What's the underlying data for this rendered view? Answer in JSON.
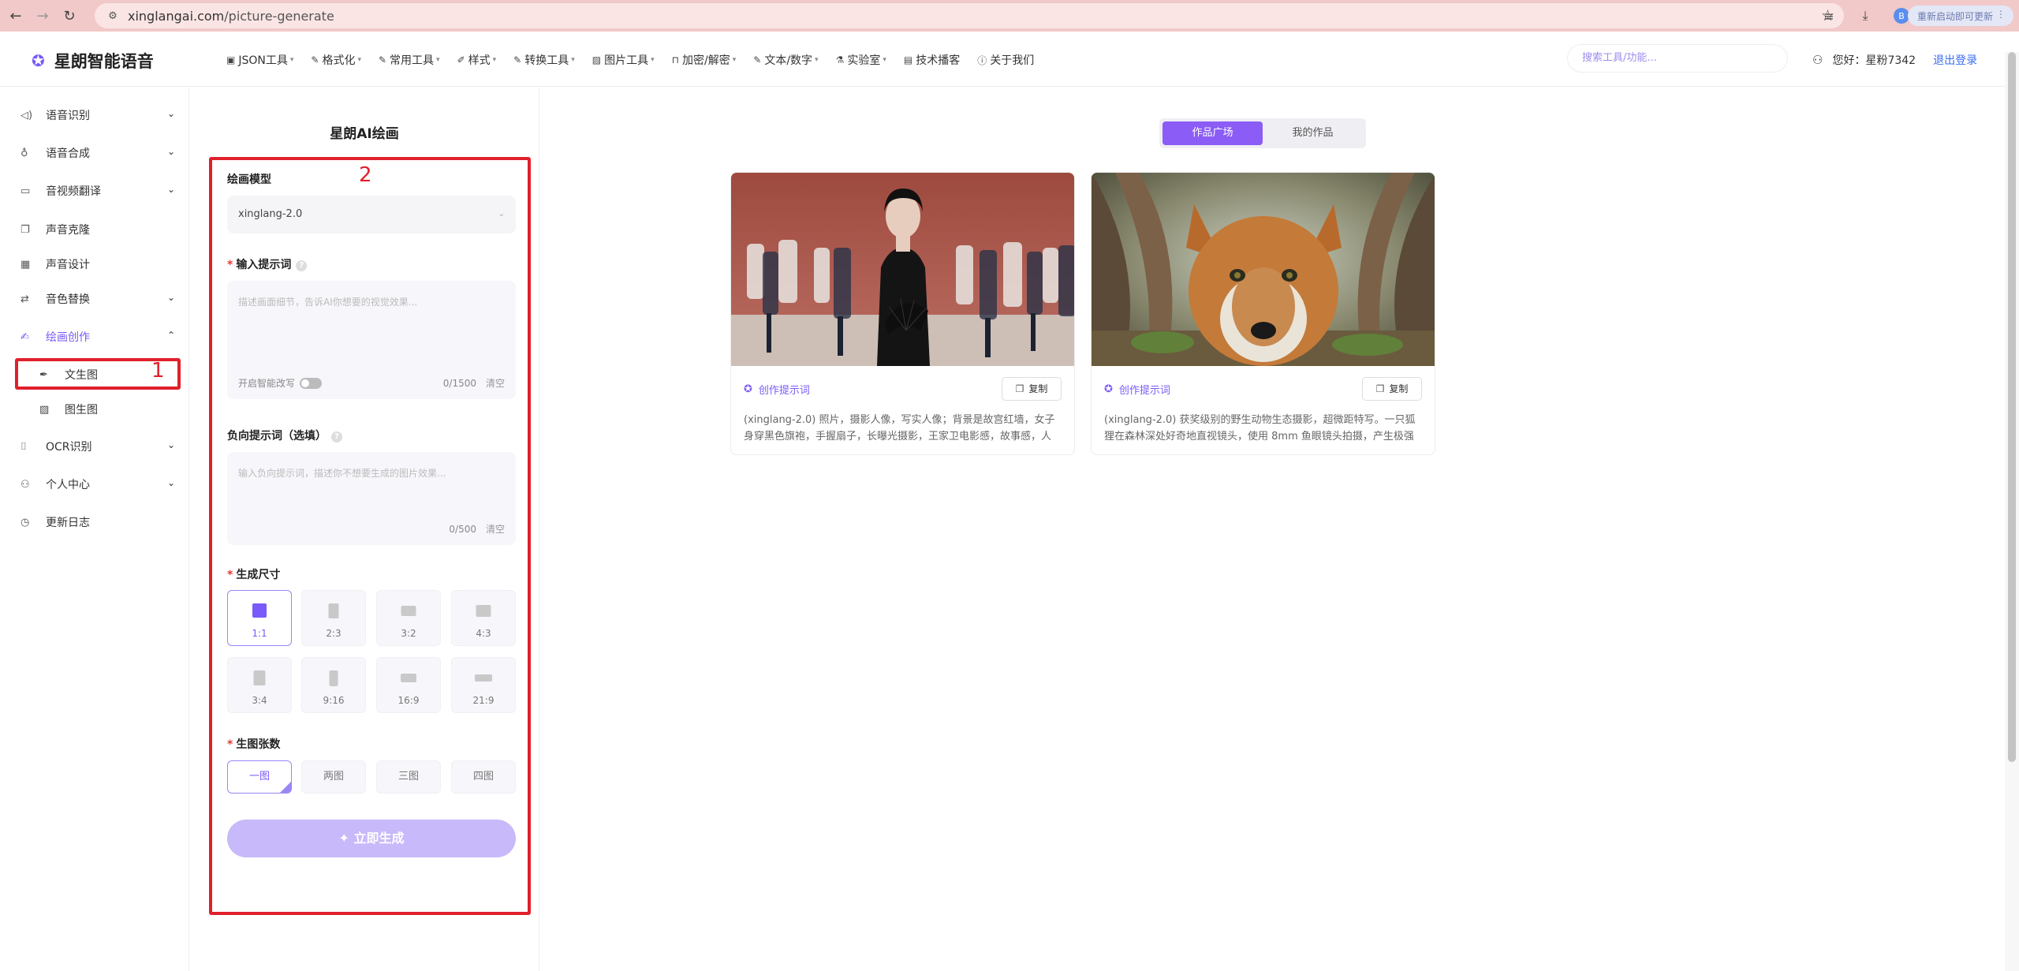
{
  "browser": {
    "url_domain": "xinglangai.com",
    "url_path": "/picture-generate",
    "profile_initial": "B",
    "update_label": "重新启动即可更新"
  },
  "header": {
    "brand": "星朗智能语音",
    "nav": [
      {
        "label": "JSON工具",
        "icon": "json-icon"
      },
      {
        "label": "格式化",
        "icon": "edit-icon"
      },
      {
        "label": "常用工具",
        "icon": "edit-icon"
      },
      {
        "label": "样式",
        "icon": "brush-icon"
      },
      {
        "label": "转换工具",
        "icon": "edit-icon"
      },
      {
        "label": "图片工具",
        "icon": "image-icon"
      },
      {
        "label": "加密/解密",
        "icon": "lock-icon"
      },
      {
        "label": "文本/数字",
        "icon": "edit-icon"
      },
      {
        "label": "实验室",
        "icon": "flask-icon"
      },
      {
        "label": "技术播客",
        "icon": "book-icon"
      },
      {
        "label": "关于我们",
        "icon": "info-icon"
      }
    ],
    "search_placeholder": "搜索工具/功能...",
    "greeting": "您好：星粉7342",
    "logout": "退出登录"
  },
  "sidebar": {
    "items": [
      {
        "label": "语音识别",
        "icon": "speaker-icon",
        "chevron": "⌄"
      },
      {
        "label": "语音合成",
        "icon": "mic-icon",
        "chevron": "⌄"
      },
      {
        "label": "音视频翻译",
        "icon": "video-icon",
        "chevron": "⌄"
      },
      {
        "label": "声音克隆",
        "icon": "copy-icon",
        "chevron": ""
      },
      {
        "label": "声音设计",
        "icon": "grid-icon",
        "chevron": ""
      },
      {
        "label": "音色替换",
        "icon": "swap-icon",
        "chevron": "⌄"
      },
      {
        "label": "绘画创作",
        "icon": "paint-icon",
        "chevron": "⌃"
      },
      {
        "label": "OCR识别",
        "icon": "scan-icon",
        "chevron": "⌄"
      },
      {
        "label": "个人中心",
        "icon": "user-icon",
        "chevron": "⌄"
      },
      {
        "label": "更新日志",
        "icon": "history-icon",
        "chevron": ""
      }
    ],
    "sub_items": [
      {
        "label": "文生图",
        "icon": "pen-icon"
      },
      {
        "label": "图生图",
        "icon": "image-icon"
      }
    ]
  },
  "annotations": {
    "one": "1",
    "two": "2"
  },
  "panel": {
    "title": "星朗AI绘画",
    "model_label": "绘画模型",
    "model_value": "xinglang-2.0",
    "prompt_label": "输入提示词",
    "prompt_placeholder": "描述画面细节，告诉AI你想要的视觉效果...",
    "smart_rewrite_label": "开启智能改写",
    "prompt_count": "0/1500",
    "clear": "清空",
    "negative_label": "负向提示词（选填）",
    "negative_placeholder": "输入负向提示词，描述你不想要生成的图片效果...",
    "negative_count": "0/500",
    "size_label": "生成尺寸",
    "sizes": [
      "1:1",
      "2:3",
      "3:2",
      "4:3",
      "3:4",
      "9:16",
      "16:9",
      "21:9"
    ],
    "selected_size": "1:1",
    "count_label": "生图张数",
    "counts": [
      "一图",
      "两图",
      "三图",
      "四图"
    ],
    "selected_count": "一图",
    "generate_button": "✦ 立即生成"
  },
  "gallery": {
    "tabs": [
      "作品广场",
      "我的作品"
    ],
    "active_tab": "作品广场",
    "cards": [
      {
        "prompt_tag": "创作提示词",
        "copy_label": "复制",
        "description": "(xinglang-2.0) 照片，摄影人像，写实人像；背景是故宫红墙，女子身穿黑色旗袍，手握扇子，长曝光摄影，王家卫电影感，故事感，人来..."
      },
      {
        "prompt_tag": "创作提示词",
        "copy_label": "复制",
        "description": "(xinglang-2.0) 获奖级别的野生动物生态摄影，超微距特写。一只狐狸在森林深处好奇地直视镜头，使用 8mm 鱼眼镜头拍摄，产生极强的..."
      }
    ]
  },
  "colors": {
    "accent": "#7a5af8",
    "annotation": "#e0202a",
    "tab_active": "#8b5cf6",
    "generate_button": "#c8b9fb"
  }
}
